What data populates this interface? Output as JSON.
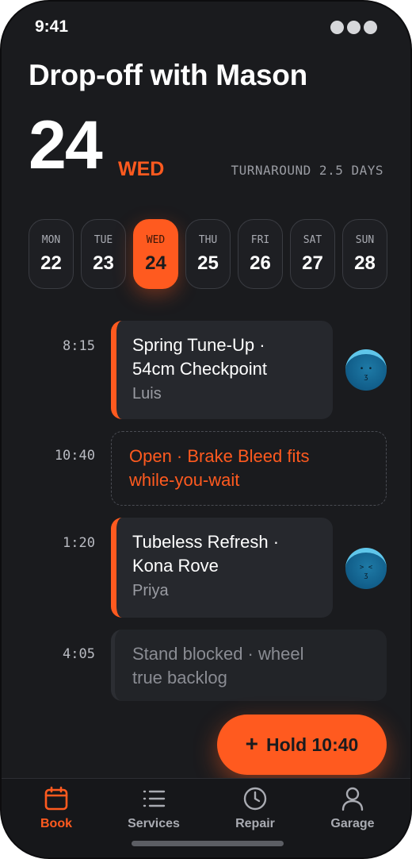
{
  "status_bar": {
    "time": "9:41"
  },
  "header": {
    "title": "Drop-off with Mason",
    "day_number": "24",
    "weekday": "WED",
    "turnaround": "TURNAROUND 2.5 DAYS"
  },
  "week": [
    {
      "name": "MON",
      "date": "22",
      "selected": false
    },
    {
      "name": "TUE",
      "date": "23",
      "selected": false
    },
    {
      "name": "WED",
      "date": "24",
      "selected": true
    },
    {
      "name": "THU",
      "date": "25",
      "selected": false
    },
    {
      "name": "FRI",
      "date": "26",
      "selected": false
    },
    {
      "name": "SAT",
      "date": "27",
      "selected": false
    },
    {
      "name": "SUN",
      "date": "28",
      "selected": false
    }
  ],
  "schedule": {
    "slot1": {
      "time": "8:15",
      "line1": "Spring Tune-Up ·",
      "line2": "54cm Checkpoint",
      "mechanic": "Luis",
      "avatar_face": "• •\nʒ"
    },
    "slot2": {
      "time": "10:40",
      "line1": "Open · Brake Bleed fits",
      "line2": "while-you-wait"
    },
    "slot3": {
      "time": "1:20",
      "line1": "Tubeless Refresh ·",
      "line2": "Kona Rove",
      "mechanic": "Priya",
      "avatar_face": "> <\nʒ"
    },
    "slot4": {
      "time": "4:05",
      "line1": "Stand blocked · wheel",
      "line2": "true backlog"
    }
  },
  "fab": {
    "icon": "plus-icon",
    "label": "Hold 10:40"
  },
  "tabs": [
    {
      "label": "Book",
      "icon": "calendar-icon",
      "active": true
    },
    {
      "label": "Services",
      "icon": "list-icon",
      "active": false
    },
    {
      "label": "Repair",
      "icon": "clock-icon",
      "active": false
    },
    {
      "label": "Garage",
      "icon": "user-icon",
      "active": false
    }
  ],
  "colors": {
    "accent": "#ff5a1f",
    "background": "#1a1b1e",
    "card": "#26282d"
  }
}
